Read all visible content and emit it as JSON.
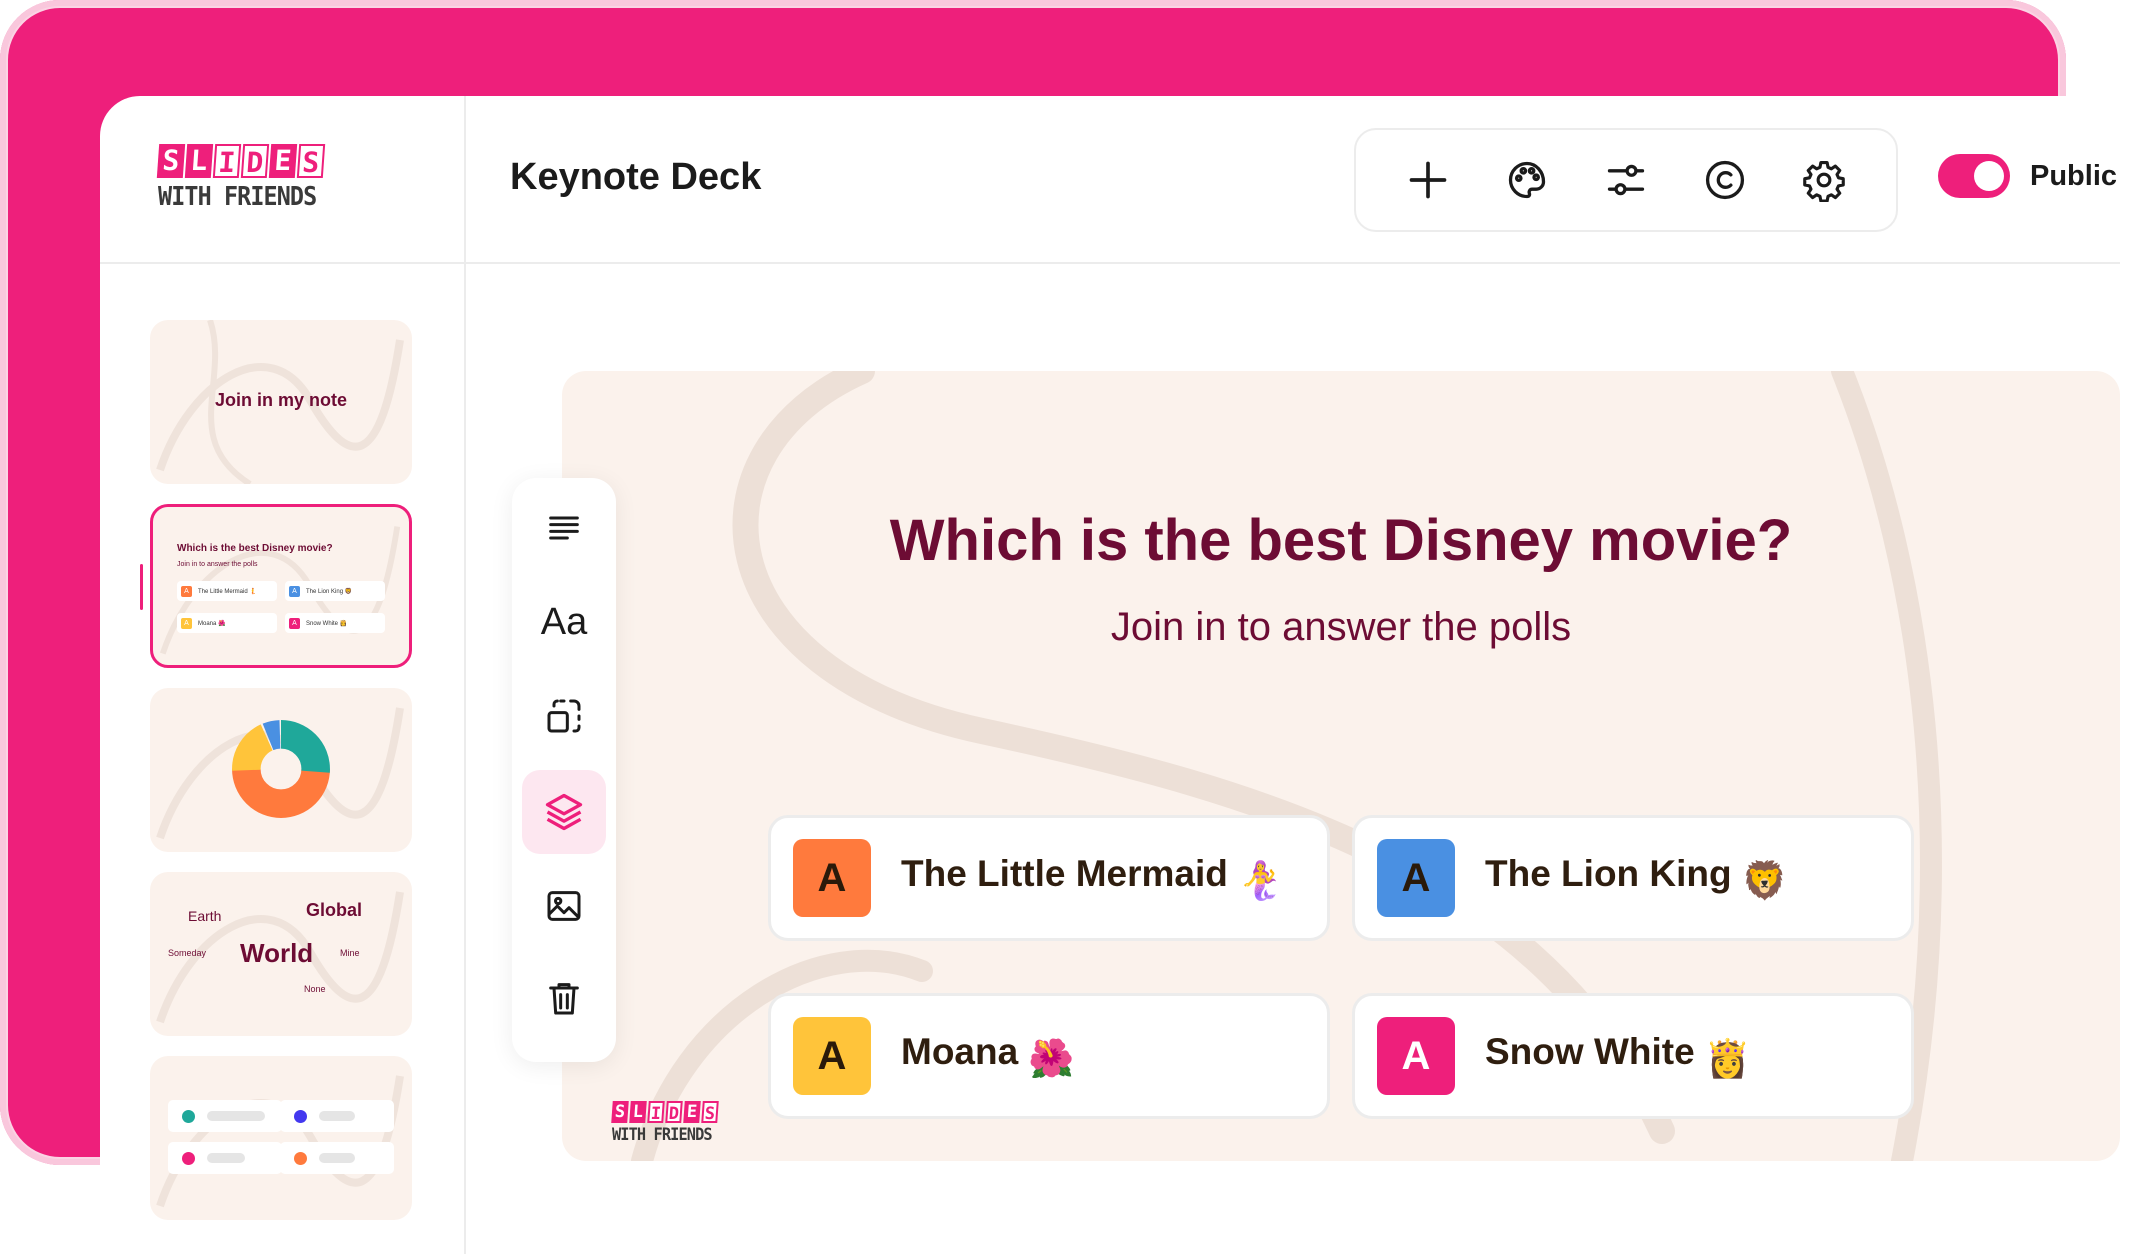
{
  "brand": {
    "logo_top": [
      "S",
      "L",
      "I",
      "D",
      "E",
      "S"
    ],
    "logo_bottom": "WITH FRIENDS"
  },
  "header": {
    "deck_title": "Keynote Deck",
    "toolbar": [
      "add-icon",
      "palette-icon",
      "sliders-icon",
      "copyright-icon",
      "settings-icon"
    ],
    "visibility_label": "Public",
    "visibility_on": true
  },
  "sidebar": {
    "slide1": {
      "text": "Join in my note"
    },
    "slide2": {
      "title": "Which is the best Disney movie?",
      "subtitle": "Join in to answer the polls",
      "options": [
        "The Little Mermaid 🧜",
        "The Lion King 🦁",
        "Moana 🌺",
        "Snow White 👸"
      ]
    },
    "slide4": {
      "words": [
        "Earth",
        "Global",
        "Someday",
        "World",
        "Mine",
        "None"
      ]
    }
  },
  "tools": [
    "align-text-icon",
    "font-icon",
    "resize-icon",
    "layers-icon",
    "image-icon",
    "trash-icon"
  ],
  "slide": {
    "question": "Which is the best Disney movie?",
    "subtitle": "Join in to answer the polls",
    "options": [
      {
        "badge": "A",
        "label": "The Little Mermaid",
        "emoji": "🧜‍♀️",
        "color": "#ff7a3d"
      },
      {
        "badge": "A",
        "label": "The Lion King",
        "emoji": "🦁",
        "color": "#4a90e2"
      },
      {
        "badge": "A",
        "label": "Moana",
        "emoji": "🌺",
        "color": "#ffc43a"
      },
      {
        "badge": "A",
        "label": "Snow White",
        "emoji": "👸",
        "color": "#ee1f7b"
      }
    ]
  },
  "colors": {
    "brand_pink": "#ee1f7b",
    "slide_bg": "#fbf2ec",
    "title_maroon": "#6d0c34"
  }
}
